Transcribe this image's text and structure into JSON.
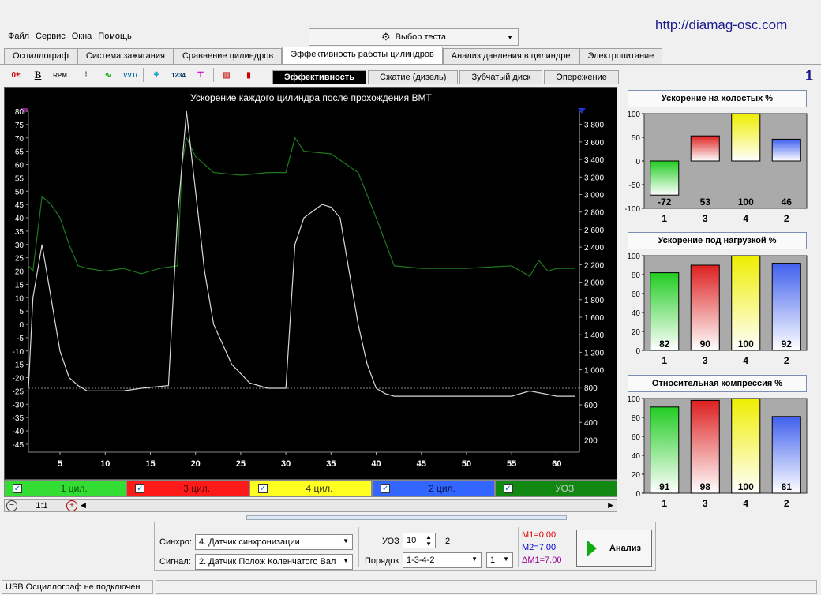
{
  "url": "http://diamag-osc.com",
  "menu": [
    "Файл",
    "Сервис",
    "Окна",
    "Помощь"
  ],
  "test_select": {
    "label": "Выбор теста",
    "icon": "gear-doc-icon"
  },
  "tabs": [
    {
      "label": "Осциллограф",
      "active": false
    },
    {
      "label": "Система зажигания",
      "active": false
    },
    {
      "label": "Сравнение цилиндров",
      "active": false
    },
    {
      "label": "Эффективность работы цилиндров",
      "active": true
    },
    {
      "label": "Анализ давления в цилиндре",
      "active": false
    },
    {
      "label": "Электропитание",
      "active": false
    }
  ],
  "toolbar": [
    "B",
    "RPM"
  ],
  "subtabs": [
    {
      "label": "Эффективность",
      "active": true
    },
    {
      "label": "Сжатие (дизель)",
      "active": false
    },
    {
      "label": "Зубчатый диск",
      "active": false
    },
    {
      "label": "Опережение",
      "active": false
    }
  ],
  "corner_number": "1",
  "chart_data": [
    {
      "type": "line",
      "title": "Ускорение каждого цилиндра после прохождения ВМТ",
      "x_ticks": [
        "5",
        "10",
        "15",
        "20",
        "25",
        "30",
        "35",
        "40",
        "45",
        "50",
        "55",
        "60"
      ],
      "x_range": [
        1.5,
        62.5
      ],
      "y_left_ticks": [
        "80",
        "75",
        "70",
        "65",
        "60",
        "55",
        "50",
        "45",
        "40",
        "35",
        "30",
        "25",
        "20",
        "15",
        "10",
        "5",
        "0",
        "-5",
        "-10",
        "-15",
        "-20",
        "-25",
        "-30",
        "-35",
        "-40",
        "-45"
      ],
      "y_left_range": [
        -48,
        80
      ],
      "y_right_ticks": [
        "3 800",
        "3 600",
        "3 400",
        "3 200",
        "3 000",
        "2 800",
        "2 600",
        "2 400",
        "2 200",
        "2 000",
        "1 800",
        "1 600",
        "1 400",
        "1 200",
        "1 000",
        "800",
        "600",
        "400",
        "200"
      ],
      "y_right_range": [
        60,
        3950
      ],
      "reference_line": -24,
      "series": [
        {
          "name": "УОЗ",
          "color": "#1f7a1f",
          "x": [
            1.5,
            2,
            3,
            4,
            5,
            6,
            7,
            8,
            10,
            12,
            14,
            16,
            18,
            18.5,
            19,
            20,
            22,
            25,
            28,
            30,
            31,
            32,
            35,
            38,
            40,
            42,
            45,
            50,
            55,
            57,
            58,
            59,
            60,
            62
          ],
          "y": [
            22,
            20,
            48,
            45,
            40,
            30,
            22,
            21,
            20,
            21,
            19,
            21,
            22,
            60,
            70,
            63,
            57,
            56,
            57,
            57,
            70,
            65,
            64,
            57,
            40,
            22,
            21,
            21,
            22,
            18,
            24,
            20,
            21,
            21
          ]
        },
        {
          "name": "RPM",
          "color": "#d8d8d8",
          "x": [
            1.5,
            2,
            3,
            4,
            5,
            6,
            7,
            8,
            10,
            12,
            14,
            17,
            18,
            19,
            20,
            21,
            22,
            24,
            26,
            28,
            30,
            31,
            32,
            34,
            35,
            36,
            37,
            38,
            39,
            40,
            41,
            42,
            45,
            50,
            55,
            57,
            60,
            62
          ],
          "y": [
            -24,
            10,
            30,
            10,
            -10,
            -20,
            -23,
            -25,
            -25,
            -25,
            -24,
            -23,
            40,
            80,
            50,
            20,
            0,
            -15,
            -22,
            -24,
            -24,
            30,
            40,
            45,
            44,
            40,
            20,
            0,
            -15,
            -24,
            -26,
            -27,
            -27,
            -27,
            -27,
            -25,
            -27,
            -27
          ]
        }
      ]
    },
    {
      "type": "bar",
      "title": "Ускорение на холостых %",
      "categories": [
        "1",
        "3",
        "4",
        "2"
      ],
      "values": [
        -72,
        53,
        100,
        46
      ],
      "ylim": [
        -100,
        100
      ],
      "y_ticks": [
        "100",
        "50",
        "0",
        "-50",
        "-100"
      ],
      "colors": [
        "#22cc22",
        "#dd2020",
        "#eeee00",
        "#4060ee"
      ]
    },
    {
      "type": "bar",
      "title": "Ускорение под нагрузкой %",
      "categories": [
        "1",
        "3",
        "4",
        "2"
      ],
      "values": [
        82,
        90,
        100,
        92
      ],
      "ylim": [
        0,
        100
      ],
      "y_ticks": [
        "100",
        "80",
        "60",
        "40",
        "20",
        "0"
      ],
      "colors": [
        "#22cc22",
        "#dd2020",
        "#eeee00",
        "#4060ee"
      ]
    },
    {
      "type": "bar",
      "title": "Относительная компрессия %",
      "categories": [
        "1",
        "3",
        "4",
        "2"
      ],
      "values": [
        91,
        98,
        100,
        81
      ],
      "ylim": [
        0,
        100
      ],
      "y_ticks": [
        "100",
        "80",
        "60",
        "40",
        "20",
        "0"
      ],
      "colors": [
        "#22cc22",
        "#dd2020",
        "#eeee00",
        "#4060ee"
      ]
    }
  ],
  "legend": [
    {
      "label": "1 цил.",
      "color": "#33dd33",
      "text": "#005500"
    },
    {
      "label": "3 цил.",
      "color": "#ff1a1a",
      "text": "#550000"
    },
    {
      "label": "4 цил.",
      "color": "#ffff22",
      "text": "#333300"
    },
    {
      "label": "2 цил.",
      "color": "#3366ff",
      "text": "#001144"
    },
    {
      "label": "УОЗ",
      "color": "#118811",
      "text": "#cccccc"
    }
  ],
  "scroll": {
    "zoom": "1:1"
  },
  "controls": {
    "sync_label": "Синхро:",
    "sync_value": "4.  Датчик синхронизации",
    "signal_label": "Сигнал:",
    "signal_value": "2.  Датчик Полож Коленчатого Вал",
    "uoz_label": "УОЗ",
    "uoz_value": "10",
    "uoz_extra": "2",
    "order_label": "Порядок",
    "order_value": "1-3-4-2",
    "order_extra": "1",
    "m1": "M1=0.00",
    "m2": "M2=7.00",
    "dm1": "ΔM1=7.00",
    "analyze": "Анализ"
  },
  "status": "USB Осциллограф не подключен"
}
